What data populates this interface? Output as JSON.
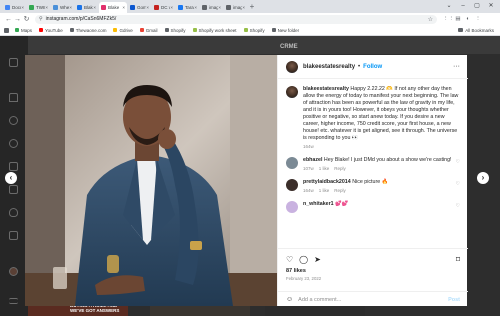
{
  "browser": {
    "tabs": [
      {
        "label": "Docu",
        "color": "#4285f4"
      },
      {
        "label": "TWII",
        "color": "#34a853"
      },
      {
        "label": "Wher",
        "color": "#4a90d9"
      },
      {
        "label": "Blakı",
        "color": "#1a73e8"
      },
      {
        "label": "Blake",
        "color": "#e1306c",
        "active": true
      },
      {
        "label": "Gom",
        "color": "#0b57d0"
      },
      {
        "label": "DC v",
        "color": "#c5221f"
      },
      {
        "label": "Taraı",
        "color": "#1877f2"
      },
      {
        "label": "imag",
        "color": "#5f6368"
      },
      {
        "label": "imag",
        "color": "#5f6368"
      }
    ],
    "close_glyph": "×",
    "new_tab_glyph": "+",
    "window_controls": [
      "⌄",
      "–",
      "▢",
      "✕"
    ],
    "nav": {
      "back": "←",
      "forward": "→",
      "reload": "↻",
      "home": "⌂"
    },
    "url": "instagram.com/p/CaSn6MFZk5/",
    "star": "☆",
    "extensions": [
      "⋮⋮",
      "▤",
      "◐",
      "⋮"
    ],
    "bookmarks": [
      {
        "label": "Maps",
        "color": "#34a853"
      },
      {
        "label": "YouTube",
        "color": "#ff0000"
      },
      {
        "label": "Thewaone.com",
        "color": "#5f6368"
      },
      {
        "label": "Gdrive",
        "color": "#fbbc04"
      },
      {
        "label": "Gmail",
        "color": "#ea4335"
      },
      {
        "label": "Shopify",
        "color": "#5f6368"
      },
      {
        "label": "Shopify work sheet",
        "color": "#96bf48"
      },
      {
        "label": "Shopify",
        "color": "#96bf48"
      },
      {
        "label": "New folder",
        "color": "#5f6368"
      }
    ],
    "all_bookmarks": "All Bookmarks"
  },
  "background": {
    "banner": "CRME",
    "bottom_text_line1": "BUYING A HOME AND",
    "bottom_text_line2": "WE'VE GOT ANSWERS",
    "prev": "‹",
    "next": "›"
  },
  "post": {
    "username": "blakeestatesrealty",
    "dot": "•",
    "follow": "Follow",
    "more": "···",
    "caption": "Happy 2.22.22 🫶 If not any other day then allow the energy of today to manifest your next beginning. The law of attraction has been as powerful as the law of gravity in my life, and it is in yours too! However, it obeys your thoughts whether positive or negative, so start anew today. If you desire a new career, higher income, 750 credit score, your first house, a new house! etc. whatever it is get aligned, see it through. The universe is responding to you 👀",
    "caption_age": "164w",
    "comments": [
      {
        "user": "ebhazel",
        "text": "Hey Blake! I just DMd you about a show we're casting!",
        "age": "107w",
        "likes": "1 like",
        "reply": "Reply",
        "color": "#7b8a95"
      },
      {
        "user": "prettylaidback2014",
        "text": "Nice picture 🔥",
        "age": "164w",
        "likes": "1 like",
        "reply": "Reply",
        "color": "#3b2e2a"
      },
      {
        "user": "n_whitaker1",
        "text": "💕💕",
        "age": "",
        "likes": "",
        "reply": "",
        "color": "#c9b2e0"
      }
    ],
    "heart": "♡",
    "actions": {
      "like": "♡",
      "comment": "◯",
      "share": "➤",
      "save": "⌑"
    },
    "likes": "87 likes",
    "date": "February 23, 2022",
    "smile": "☺",
    "comment_placeholder": "Add a comment...",
    "post_button": "Post"
  }
}
